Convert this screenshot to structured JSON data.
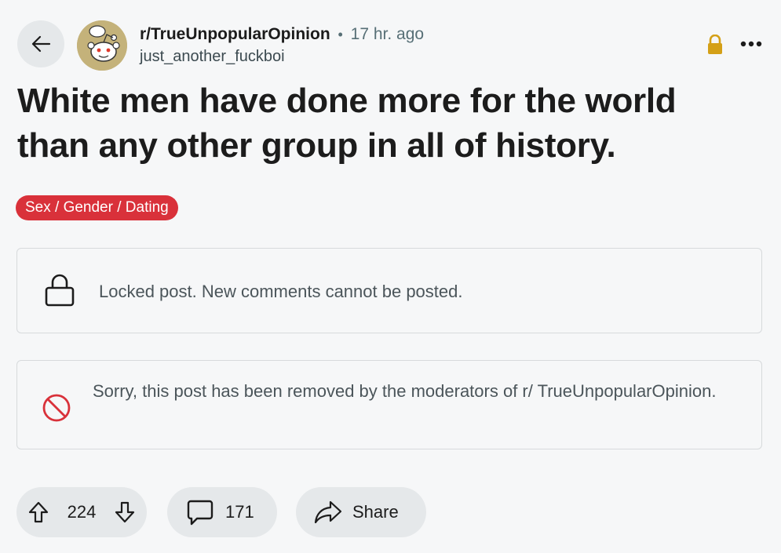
{
  "post": {
    "subreddit": "r/TrueUnpopularOpinion",
    "separator": "•",
    "time": "17 hr. ago",
    "author": "just_another_fuckboi",
    "title": "White men have done more for the world than any other group in all of history.",
    "flair": "Sex / Gender / Dating"
  },
  "notices": {
    "locked": "Locked post. New comments cannot be posted.",
    "removed": "Sorry, this post has been removed by the moderators of r/ TrueUnpopularOpinion."
  },
  "actions": {
    "votes": "224",
    "comments": "171",
    "share": "Share"
  },
  "icons": {
    "back": "arrow-left-icon",
    "lock_top": "lock-icon",
    "more": "more-horizontal-icon",
    "lock_notice": "lock-icon",
    "removed": "ban-icon",
    "upvote": "arrow-up-icon",
    "downvote": "arrow-down-icon",
    "comment": "comment-icon",
    "share": "share-icon"
  },
  "colors": {
    "flair_bg": "#d9313a",
    "lock_top": "#d4a017",
    "ban": "#d9313a",
    "pill_bg": "#e5e8ea",
    "page_bg": "#f6f7f8"
  }
}
